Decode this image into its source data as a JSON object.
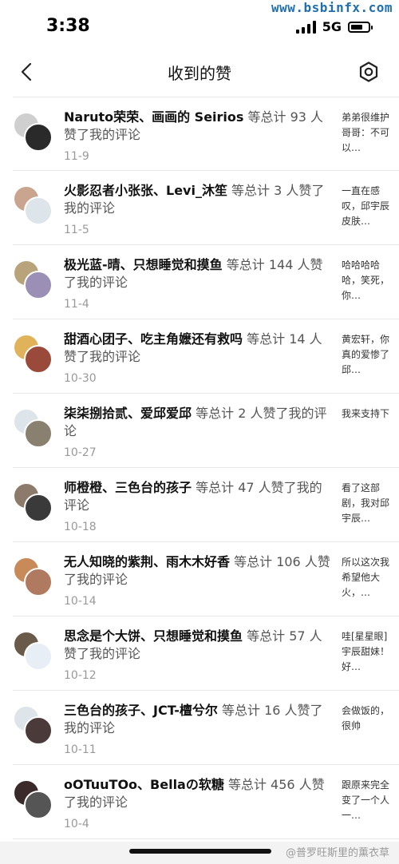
{
  "watermark_top": "www.bsbinfx.com",
  "status_bar": {
    "time": "3:38",
    "network": "5G",
    "battery_level": 0.7
  },
  "nav": {
    "title": "收到的赞"
  },
  "items": [
    {
      "names": "Naruto荣荣、画画的 Seirios",
      "count_text": " 等总计 93 人赞了我的评论",
      "date": "11-9",
      "snippet": "弟弟很维护哥哥：不可以…",
      "av1": "#cfcfcf",
      "av2": "#2a2a2a"
    },
    {
      "names": "火影忍者小张张、Levi_沐笙",
      "count_text": " 等总计 3 人赞了我的评论",
      "date": "11-5",
      "snippet": "一直在感叹，邱宇辰皮肤…",
      "av1": "#c9a48f",
      "av2": "#dde4ea"
    },
    {
      "names": "极光蓝-晴、只想睡觉和摸鱼",
      "count_text": " 等总计 144 人赞了我的评论",
      "date": "11-4",
      "snippet": "哈哈哈哈哈，笑死，你…",
      "av1": "#b8a37a",
      "av2": "#9b8fb5"
    },
    {
      "names": "甜酒心团子、吃主角嬷还有救吗",
      "count_text": " 等总计 14 人赞了我的评论",
      "date": "10-30",
      "snippet": "黄宏轩，你真的爱惨了邱…",
      "av1": "#e0b35a",
      "av2": "#9a4a3a"
    },
    {
      "names": "柒柒捌拾贰、爱邱爱邱",
      "count_text": " 等总计 2 人赞了我的评论",
      "date": "10-27",
      "snippet": "我来支持下",
      "av1": "#dde4ea",
      "av2": "#8a8070"
    },
    {
      "names": "师橙橙、三色台的孩子",
      "count_text": " 等总计 47 人赞了我的评论",
      "date": "10-18",
      "snippet": "看了这部剧，我对邱宇辰…",
      "av1": "#8c7a6a",
      "av2": "#3a3a3a"
    },
    {
      "names": "无人知晓的紫荆、雨木木好香",
      "count_text": " 等总计 106 人赞了我的评论",
      "date": "10-14",
      "snippet": "所以这次我希望他大火，…",
      "av1": "#c98a5a",
      "av2": "#b07a60"
    },
    {
      "names": "思念是个大饼、只想睡觉和摸鱼",
      "count_text": " 等总计 57 人赞了我的评论",
      "date": "10-12",
      "snippet": "哇[星星眼]宇辰甜妹！好…",
      "av1": "#6a5a4a",
      "av2": "#e8eef6"
    },
    {
      "names": "三色台的孩子、JCT-檀兮尔",
      "count_text": " 等总计 16 人赞了我的评论",
      "date": "10-11",
      "snippet": "会做饭的，很帅",
      "av1": "#dde4ea",
      "av2": "#4a3a3a"
    },
    {
      "names": "oOTuuTOo、Bellaの软糖",
      "count_text": " 等总计 456 人赞了我的评论",
      "date": "10-4",
      "snippet": "跟原来完全变了一个人一…",
      "av1": "#3a2a2a",
      "av2": "#555555"
    }
  ],
  "watermark_bottom": "@普罗旺斯里的薰衣草"
}
